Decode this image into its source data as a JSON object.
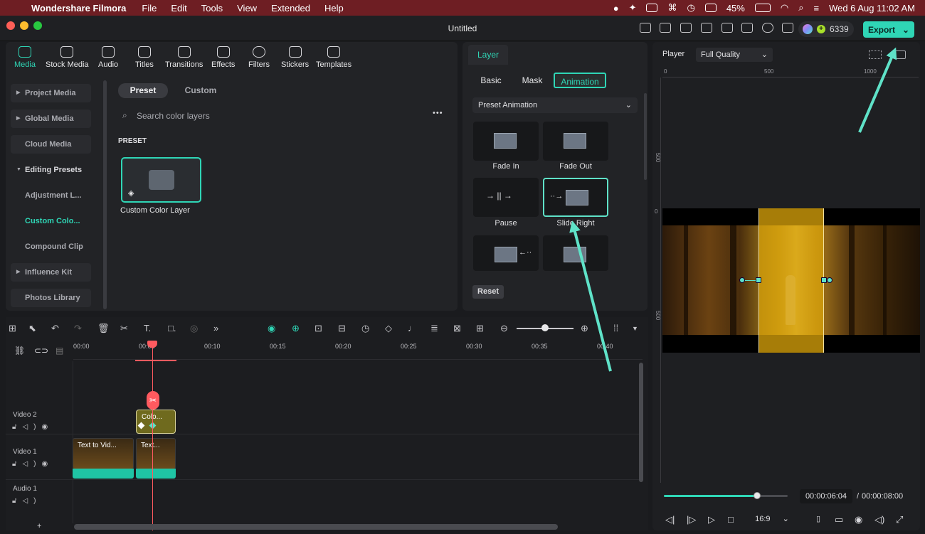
{
  "menubar": {
    "app": "Wondershare Filmora",
    "items": [
      "File",
      "Edit",
      "Tools",
      "View",
      "Extended",
      "Help"
    ],
    "battery": "45%",
    "datetime": "Wed 6 Aug  11:02 AM"
  },
  "titlebar": {
    "title": "Untitled",
    "credits": "6339",
    "export_label": "Export"
  },
  "media_toolbar": {
    "tools": [
      "Media",
      "Stock Media",
      "Audio",
      "Titles",
      "Transitions",
      "Effects",
      "Filters",
      "Stickers",
      "Templates"
    ],
    "active": "Media"
  },
  "sidebar": {
    "items": [
      "Project Media",
      "Global Media",
      "Cloud Media",
      "Editing Presets",
      "Adjustment L...",
      "Custom Colo...",
      "Compound Clip",
      "Influence Kit",
      "Photos Library"
    ]
  },
  "library": {
    "tabs": [
      "Preset",
      "Custom"
    ],
    "search_placeholder": "Search color layers",
    "more_glyph": "•••",
    "section_label": "PRESET",
    "card_label": "Custom Color Layer"
  },
  "layer_panel": {
    "header_tab": "Layer",
    "segments": [
      "Basic",
      "Mask",
      "Animation"
    ],
    "preset_dropdown": "Preset Animation",
    "animations": [
      "Fade In",
      "Fade Out",
      "Pause",
      "Slide Right"
    ],
    "reset_label": "Reset",
    "selected": "Slide Right"
  },
  "player": {
    "label": "Player",
    "quality": "Full Quality",
    "ruler_h": [
      "0",
      "500",
      "1000"
    ],
    "ruler_v": [
      "500",
      "0",
      "500"
    ],
    "current_time": "00:00:06:04",
    "separator": "/",
    "total_time": "00:00:08:00",
    "aspect": "16:9",
    "progress": 0.75
  },
  "timeline": {
    "ticks": [
      "00:00",
      "00:05",
      "00:10",
      "00:15",
      "00:20",
      "00:25",
      "00:30",
      "00:35",
      "00:40"
    ],
    "tracks": [
      "Video 2",
      "Video 1",
      "Audio 1"
    ],
    "clip_v2": "Colo...",
    "clip_v1a": "Text to Vid...",
    "clip_v1b": "Text..."
  },
  "colors": {
    "accent": "#2fd6b6",
    "playhead": "#ff5a5f",
    "menubar": "#6e1e23"
  }
}
